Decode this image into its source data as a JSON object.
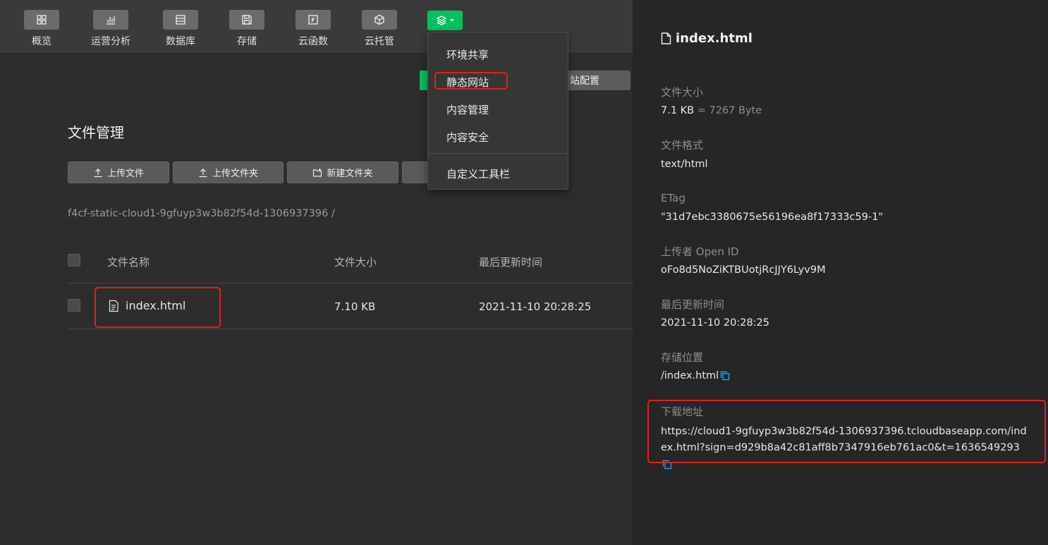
{
  "toolbar": {
    "items": [
      {
        "label": "概览",
        "icon": "grid-icon"
      },
      {
        "label": "运营分析",
        "icon": "bar-chart-icon"
      },
      {
        "label": "数据库",
        "icon": "database-icon"
      },
      {
        "label": "存储",
        "icon": "save-icon"
      },
      {
        "label": "云函数",
        "icon": "function-icon"
      },
      {
        "label": "云托管",
        "icon": "cube-icon"
      }
    ],
    "active_icon": "layers-icon",
    "accent": "#07c160"
  },
  "dropdown": {
    "items": [
      "环境共享",
      "静态网站",
      "内容管理",
      "内容安全",
      "自定义工具栏"
    ]
  },
  "main": {
    "site_config_label": "站配置",
    "title": "文件管理",
    "buttons": {
      "upload_file": "上传文件",
      "upload_folder": "上传文件夹",
      "new_folder": "新建文件夹"
    },
    "breadcrumb": "f4cf-static-cloud1-9gfuyp3w3b82f54d-1306937396  /",
    "table": {
      "headers": [
        "文件名称",
        "文件大小",
        "最后更新时间"
      ],
      "rows": [
        {
          "name": "index.html",
          "size": "7.10 KB",
          "updated": "2021-11-10 20:28:25"
        }
      ]
    }
  },
  "panel": {
    "title": "index.html",
    "file_size_label": "文件大小",
    "file_size_value": "7.1 KB",
    "file_size_bytes": "= 7267 Byte",
    "format_label": "文件格式",
    "format_value": "text/html",
    "etag_label": "ETag",
    "etag_value": "\"31d7ebc3380675e56196ea8f17333c59-1\"",
    "uploader_label": "上传者 Open ID",
    "uploader_value": "oFo8d5NoZiKTBUotjRcJJY6Lyv9M",
    "updated_label": "最后更新时间",
    "updated_value": "2021-11-10 20:28:25",
    "location_label": "存储位置",
    "location_value": "/index.html",
    "download_label": "下载地址",
    "download_value": "https://cloud1-9gfuyp3w3b82f54d-1306937396.tcloudbaseapp.com/index.html?sign=d929b8a42c81aff8b7347916eb761ac0&t=1636549293"
  },
  "colors": {
    "highlight": "#e02020",
    "copy_icon": "#1e9fff"
  }
}
